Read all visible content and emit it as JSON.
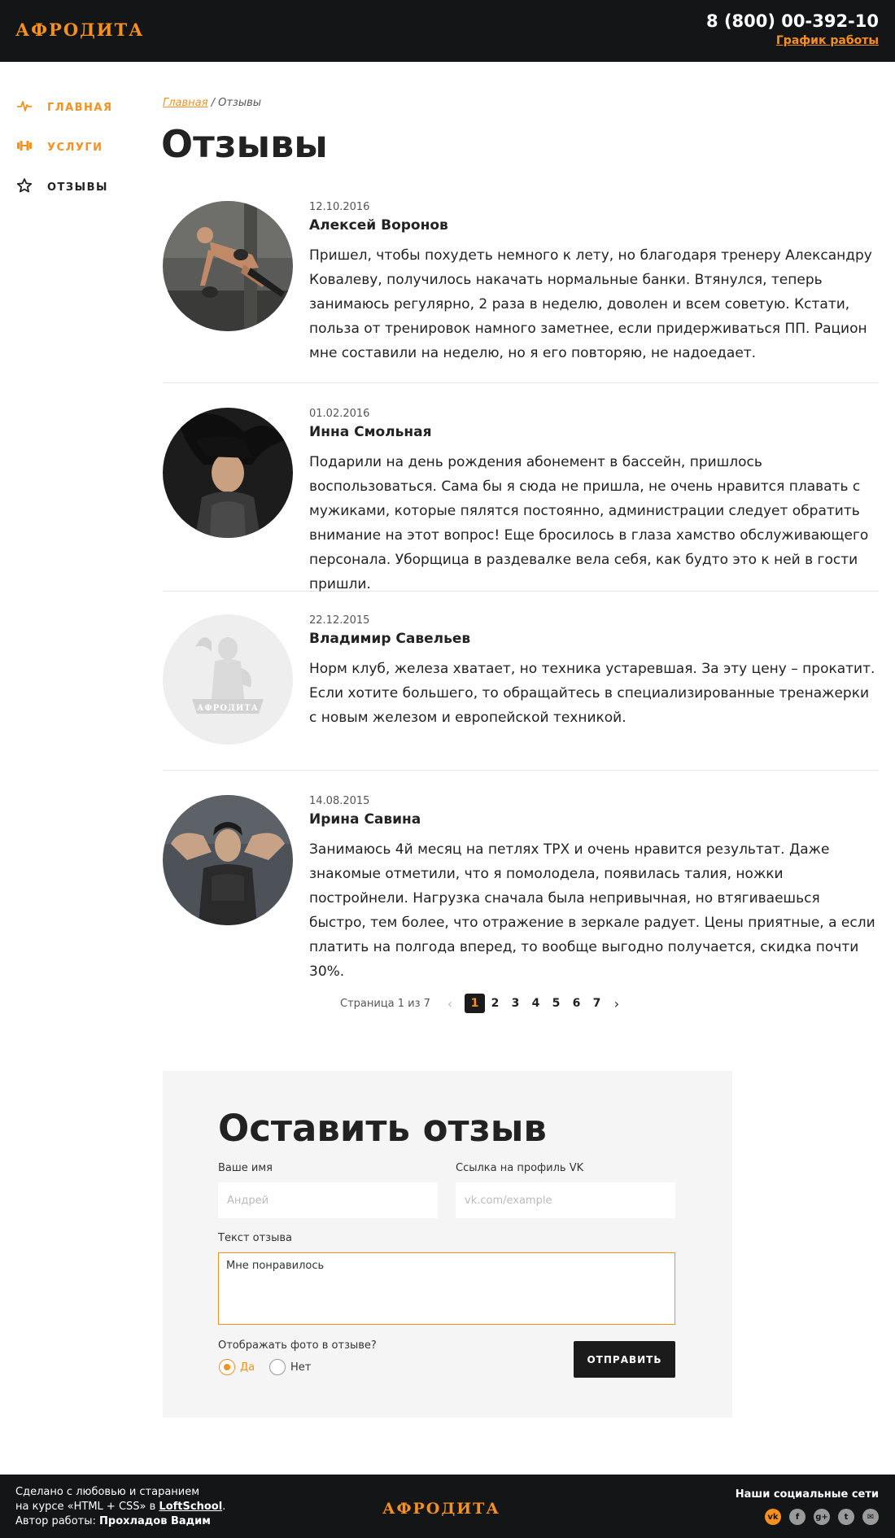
{
  "header": {
    "logo": "АФРОДИТА",
    "phone": "8 (800) 00-392-10",
    "schedule_link": "График работы"
  },
  "sidebar": {
    "items": [
      {
        "label": "ГЛАВНАЯ",
        "icon": "pulse-icon",
        "color": "#f6901e"
      },
      {
        "label": "УСЛУГИ",
        "icon": "dumbbell-icon",
        "color": "#f6901e"
      },
      {
        "label": "ОТЗЫВЫ",
        "icon": "star-icon",
        "color": "#222222"
      }
    ]
  },
  "breadcrumb": {
    "home": "Главная",
    "separator": " / ",
    "current": "Отзывы"
  },
  "page_title": "Отзывы",
  "reviews": [
    {
      "date": "12.10.2016",
      "name": "Алексей Воронов",
      "text": "Пришел, чтобы похудеть немного к лету, но благодаря тренеру Александру Ковалеву, получилось накачать нормальные банки. Втянулся, теперь занимаюсь регулярно, 2 раза в неделю, доволен и всем советую. Кстати, польза от тренировок намного заметнее, если придерживаться ПП. Рацион мне составили на неделю, но я его повторяю, не надоедает.",
      "avatar": "man-pushup-photo"
    },
    {
      "date": "01.02.2016",
      "name": "Инна Смольная",
      "text": "Подарили на день рождения абонемент в бассейн, пришлось воспользоваться. Сама бы я сюда не пришла, не очень нравится плавать с мужиками, которые пялятся постоянно, администрации следует обратить внимание на этот вопрос! Еще бросилось в глаза хамство обслуживающего персонала. Уборщица в раздевалке вела себя, как будто это к ней в гости пришли.",
      "avatar": "woman-hair-photo"
    },
    {
      "date": "22.12.2015",
      "name": "Владимир Савельев",
      "text": "Норм клуб, железа хватает, но техника устаревшая. За эту цену – прокатит. Если хотите большего, то обращайтесь в специализированные тренажерки с новым железом и европейской техникой.",
      "avatar": "placeholder-logo",
      "avatar_logo_text": "АФРОДИТА"
    },
    {
      "date": "14.08.2015",
      "name": "Ирина Савина",
      "text": "Занимаюсь 4й месяц на петлях TPX и очень нравится результат. Даже знакомые отметили, что я помолодела, появилась талия, ножки постройнели. Нагрузка сначала была непривычная, но втягиваешься быстро, тем более, что отражение в зеркале радует. Цены приятные, а если платить на полгода вперед, то вообще выгодно получается, скидка почти 30%.",
      "avatar": "woman-gym-photo"
    }
  ],
  "pagination": {
    "label": "Страница 1 из 7",
    "current": 1,
    "pages": [
      "1",
      "2",
      "3",
      "4",
      "5",
      "6",
      "7"
    ],
    "prev_icon": "chevron-left-icon",
    "next_icon": "chevron-right-icon"
  },
  "form": {
    "title": "Оставить отзыв",
    "name_label": "Ваше имя",
    "name_placeholder": "Андрей",
    "vk_label": "Ссылка на профиль VK",
    "vk_placeholder": "vk.com/example",
    "text_label": "Текст отзыва",
    "text_value": "Мне понравилось",
    "photo_question": "Отображать фото в отзыве?",
    "option_yes": "Да",
    "option_no": "Нет",
    "selected_option": "Да",
    "submit": "ОТПРАВИТЬ"
  },
  "footer": {
    "line1": "Сделано с любовью и старанием",
    "line2_prefix": "на курсе «HTML + CSS» в ",
    "line2_link": "LoftSchool",
    "line2_suffix": ".",
    "line3_prefix": "Автор работы: ",
    "line3_author": "Прохладов Вадим",
    "logo": "АФРОДИТА",
    "social_title": "Наши социальные сети",
    "socials": [
      "vk-icon",
      "facebook-icon",
      "google-plus-icon",
      "twitter-icon",
      "mail-icon"
    ]
  },
  "colors": {
    "accent": "#f6901e",
    "dark": "#141517",
    "text": "#222222"
  }
}
